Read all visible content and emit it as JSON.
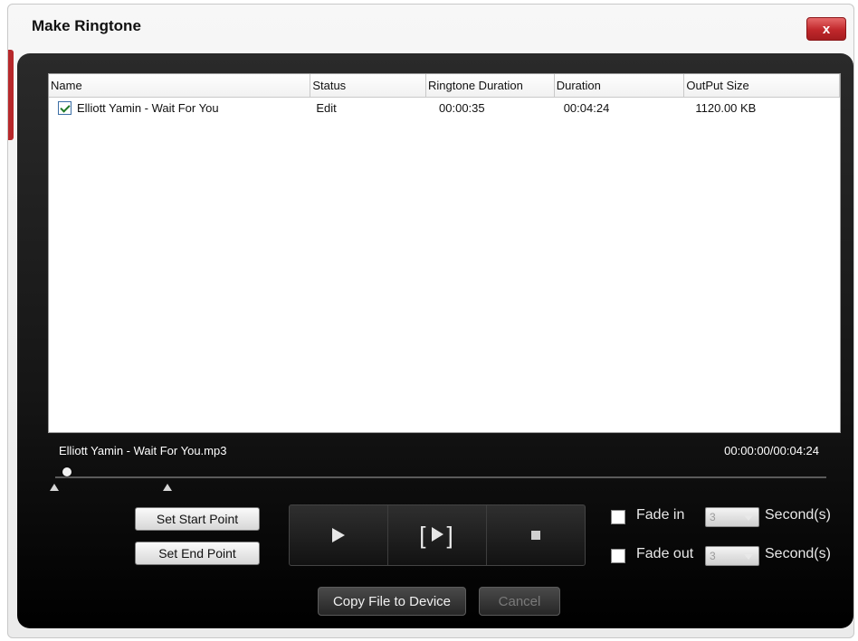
{
  "window": {
    "title": "Make Ringtone",
    "close_icon_text": "x"
  },
  "table": {
    "columns": [
      "Name",
      "Status",
      "Ringtone Duration",
      "Duration",
      "OutPut Size"
    ],
    "rows": [
      {
        "checked": true,
        "name": "Elliott Yamin - Wait For You",
        "status": "Edit",
        "ringtone_duration": "00:00:35",
        "duration": "00:04:24",
        "output_size": "1120.00 KB"
      }
    ]
  },
  "player": {
    "file_name": "Elliott Yamin - Wait For You.mp3",
    "timecode": "00:00:00/00:04:24",
    "position_fraction": 0.0
  },
  "buttons": {
    "set_start": "Set Start Point",
    "set_end": "Set End Point",
    "copy": "Copy File to Device",
    "cancel": "Cancel"
  },
  "fade": {
    "in_label": "Fade in",
    "out_label": "Fade out",
    "in_value": "3",
    "out_value": "3",
    "seconds_label": "Second(s)"
  },
  "colors": {
    "close_red": "#c0272b",
    "panel_dark": "#151515"
  }
}
